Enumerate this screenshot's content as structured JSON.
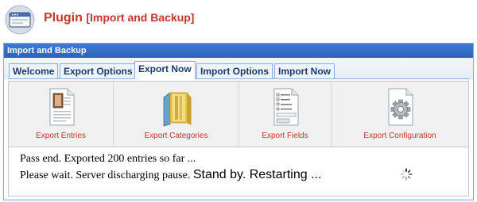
{
  "header": {
    "title_plugin": "Plugin",
    "title_section": "[Import and Backup]",
    "logo_icon": "plugin-monitor-icon"
  },
  "panel": {
    "title": "Import and Backup"
  },
  "tabs": [
    {
      "label": "Welcome",
      "active": false
    },
    {
      "label": "Export Options",
      "active": false
    },
    {
      "label": "Export Now",
      "active": true
    },
    {
      "label": "Import Options",
      "active": false
    },
    {
      "label": "Import Now",
      "active": false
    }
  ],
  "export_items": [
    {
      "label": "Export Entries",
      "icon": "document-entries-icon"
    },
    {
      "label": "Export Categories",
      "icon": "folder-categories-icon"
    },
    {
      "label": "Export Fields",
      "icon": "form-fields-icon"
    },
    {
      "label": "Export Configuration",
      "icon": "gear-configuration-icon"
    }
  ],
  "status": {
    "line1": "Pass end. Exported 200 entries so far ...",
    "line2_prefix": "Please wait. Server discharging pause.",
    "line2_suffix": "Stand by. Restarting ..."
  },
  "colors": {
    "title_red": "#c0392b",
    "panel_blue": "#2c63b8",
    "tab_text": "#1a3a6b"
  }
}
